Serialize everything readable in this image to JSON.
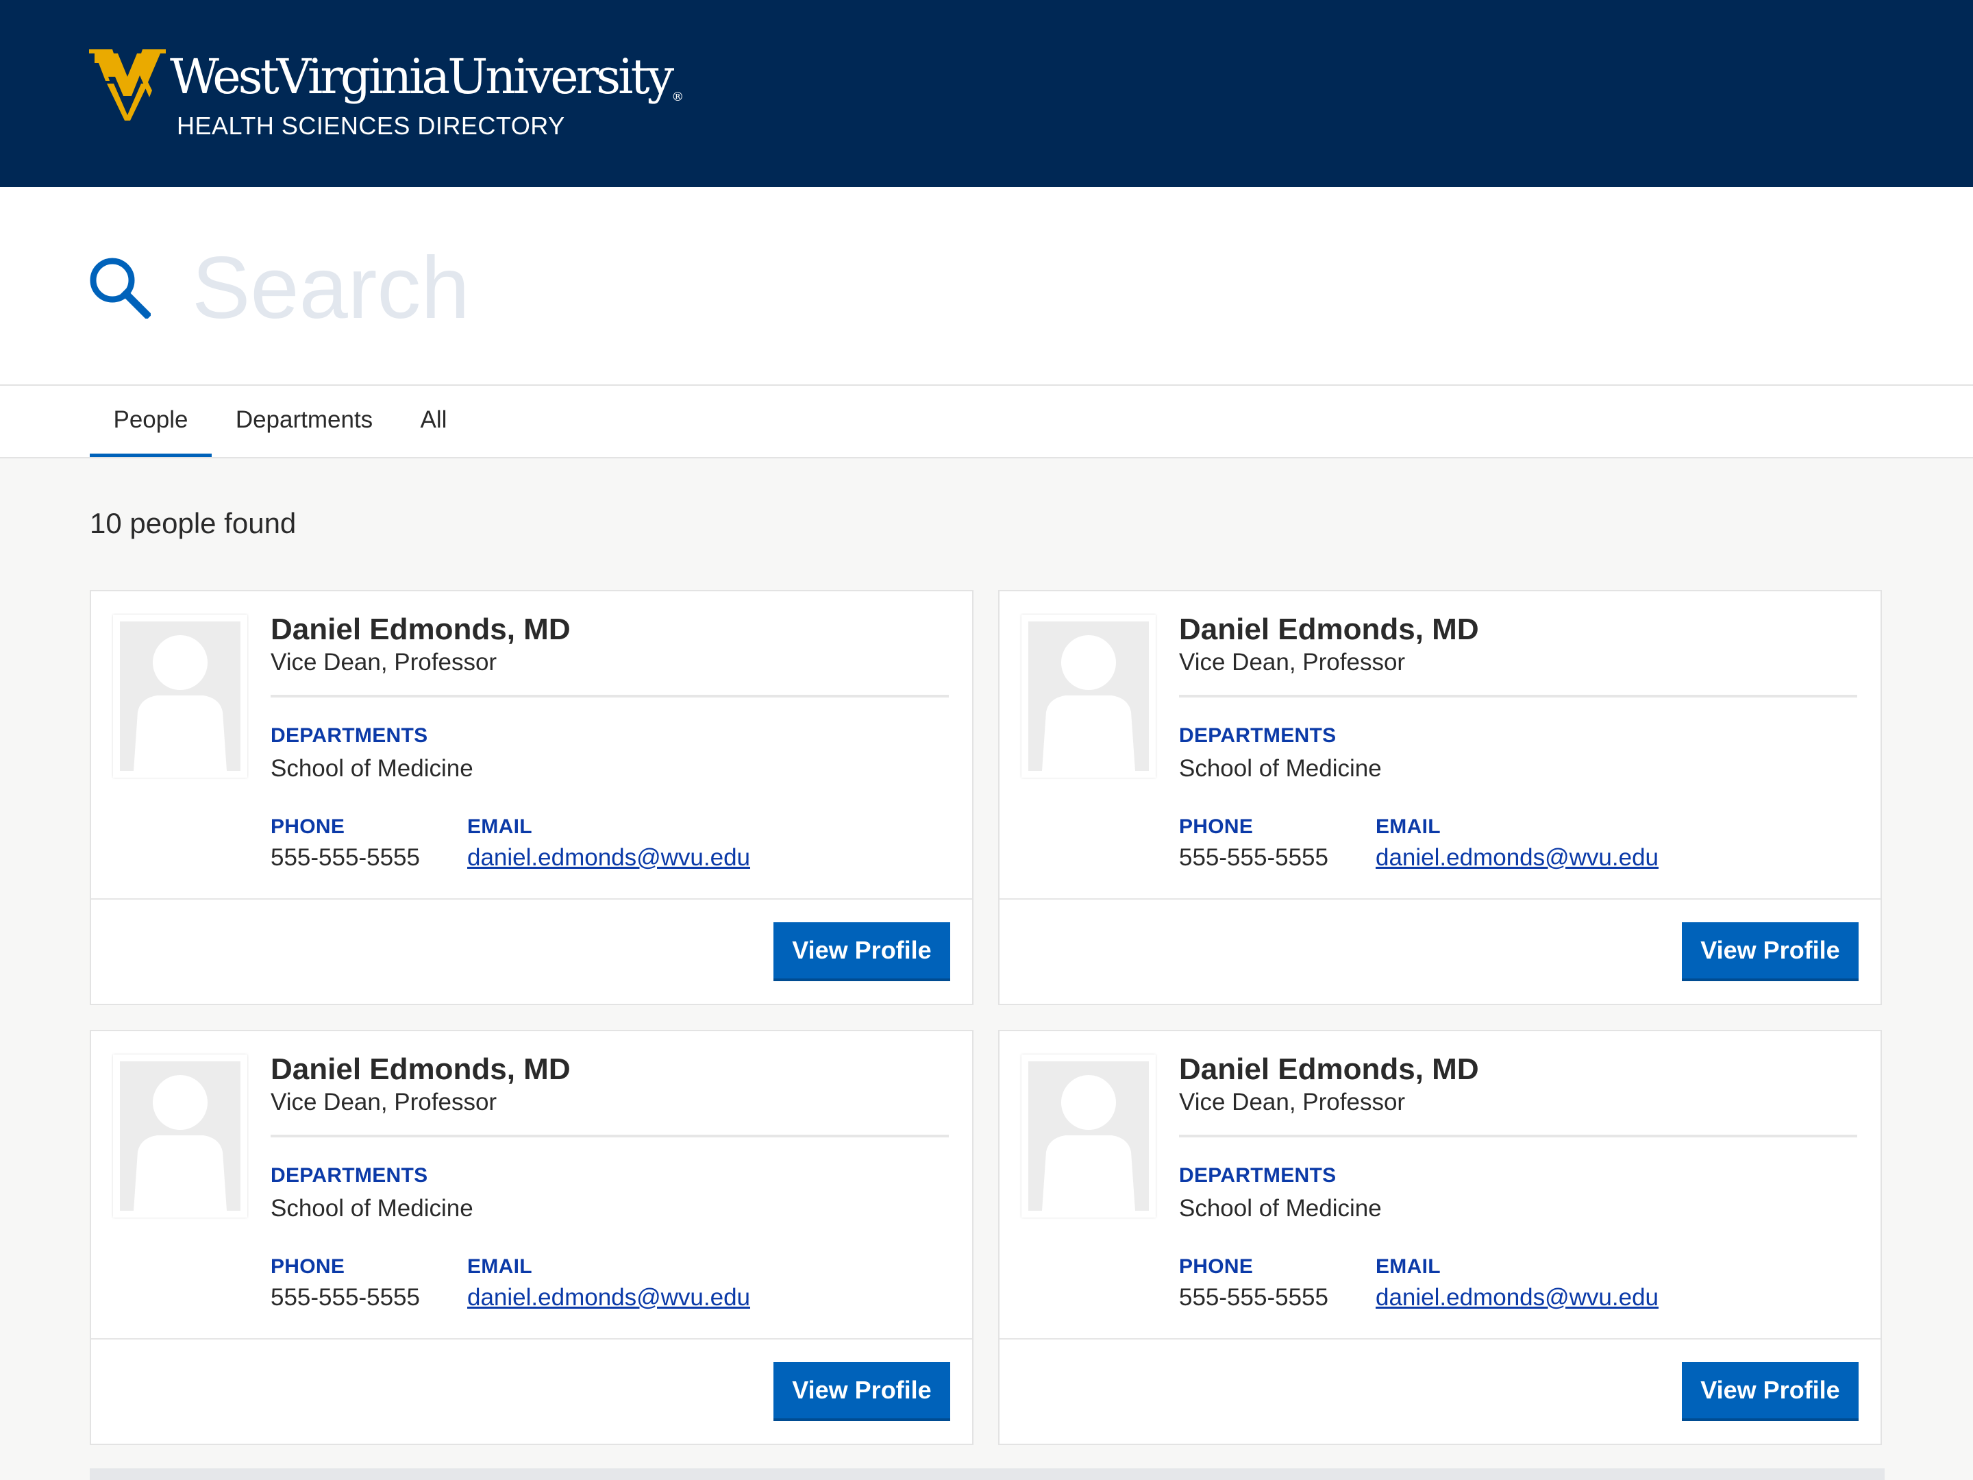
{
  "header": {
    "logo_text": "WestVirginiaUniversity",
    "trademark": "®",
    "subtitle": "HEALTH SCIENCES DIRECTORY",
    "logo_colors": {
      "brand_blue": "#002855",
      "brand_gold": "#EAAA00"
    }
  },
  "search": {
    "placeholder": "Search",
    "value": "",
    "icon": "search-icon"
  },
  "tabs": [
    {
      "label": "People",
      "active": true
    },
    {
      "label": "Departments",
      "active": false
    },
    {
      "label": "All",
      "active": false
    }
  ],
  "results": {
    "count_text": "10 people found"
  },
  "cards": [
    {
      "name": "Daniel Edmonds, MD",
      "title": "Vice Dean, Professor",
      "departments_label": "DEPARTMENTS",
      "department": "School of Medicine",
      "phone_label": "PHONE",
      "phone": "555-555-5555",
      "email_label": "EMAIL",
      "email": "daniel.edmonds@wvu.edu",
      "button": "View Profile"
    },
    {
      "name": "Daniel Edmonds, MD",
      "title": "Vice Dean, Professor",
      "departments_label": "DEPARTMENTS",
      "department": "School of Medicine",
      "phone_label": "PHONE",
      "phone": "555-555-5555",
      "email_label": "EMAIL",
      "email": "daniel.edmonds@wvu.edu",
      "button": "View Profile"
    },
    {
      "name": "Daniel Edmonds, MD",
      "title": "Vice Dean, Professor",
      "departments_label": "DEPARTMENTS",
      "department": "School of Medicine",
      "phone_label": "PHONE",
      "phone": "555-555-5555",
      "email_label": "EMAIL",
      "email": "daniel.edmonds@wvu.edu",
      "button": "View Profile"
    },
    {
      "name": "Daniel Edmonds, MD",
      "title": "Vice Dean, Professor",
      "departments_label": "DEPARTMENTS",
      "department": "School of Medicine",
      "phone_label": "PHONE",
      "phone": "555-555-5555",
      "email_label": "EMAIL",
      "email": "daniel.edmonds@wvu.edu",
      "button": "View Profile"
    }
  ],
  "colors": {
    "header_bg": "#002855",
    "accent": "#0062BA",
    "label_blue": "#0B3AA8",
    "page_bg": "#F7F7F6",
    "placeholder": "#E2E7EE"
  }
}
